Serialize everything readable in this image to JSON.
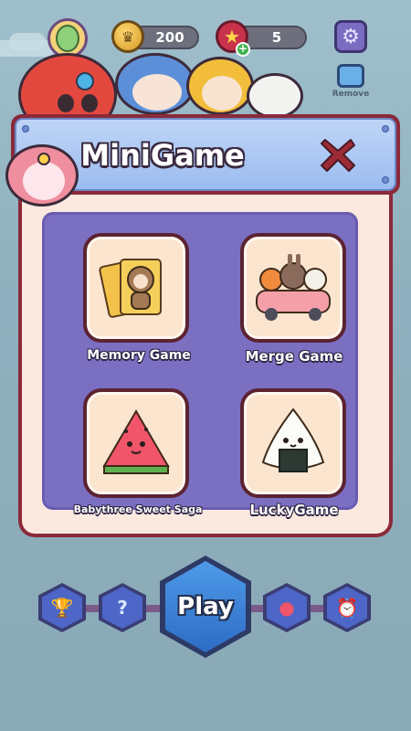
{
  "topbar": {
    "coins": "200",
    "stars": "5",
    "remove_label": "Remove"
  },
  "modal": {
    "title": "MiniGame",
    "games": [
      {
        "label": "Memory Game"
      },
      {
        "label": "Merge Game"
      },
      {
        "label": "Babythree Sweet Saga"
      },
      {
        "label": "LuckyGame"
      }
    ]
  },
  "bottom_nav": {
    "play_label": "Play",
    "items": [
      "trophy-icon",
      "map-icon",
      "mascot-icon",
      "alarm-clock-icon"
    ]
  },
  "colors": {
    "modal_border": "#8a2a3a",
    "panel": "#7b6fc2",
    "header": "#9bbcf0",
    "play": "#2d6cc5"
  }
}
